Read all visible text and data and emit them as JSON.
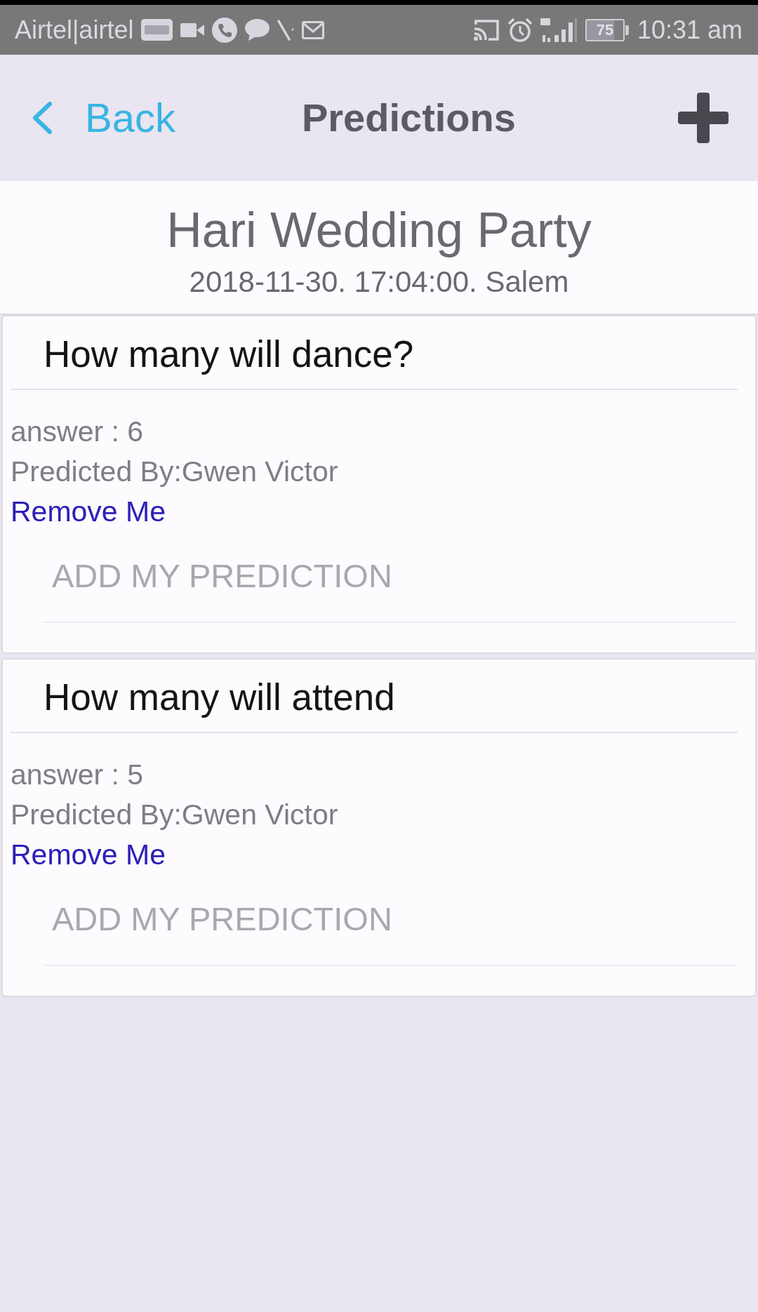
{
  "status_bar": {
    "carrier": "Airtel|airtel",
    "battery": "75",
    "time": "10:31 am"
  },
  "nav_bar": {
    "back": "Back",
    "title": "Predictions"
  },
  "event": {
    "title": "Hari Wedding Party",
    "details": "2018-11-30. 17:04:00. Salem"
  },
  "questions": [
    {
      "question": "How many will dance?",
      "answer": "answer : 6",
      "predicted_by": "Predicted By:Gwen Victor",
      "remove_link": "Remove Me",
      "add_button": "ADD MY PREDICTION"
    },
    {
      "question": "How many will attend",
      "answer": "answer : 5",
      "predicted_by": "Predicted By:Gwen Victor",
      "remove_link": "Remove Me",
      "add_button": "ADD MY PREDICTION"
    }
  ]
}
